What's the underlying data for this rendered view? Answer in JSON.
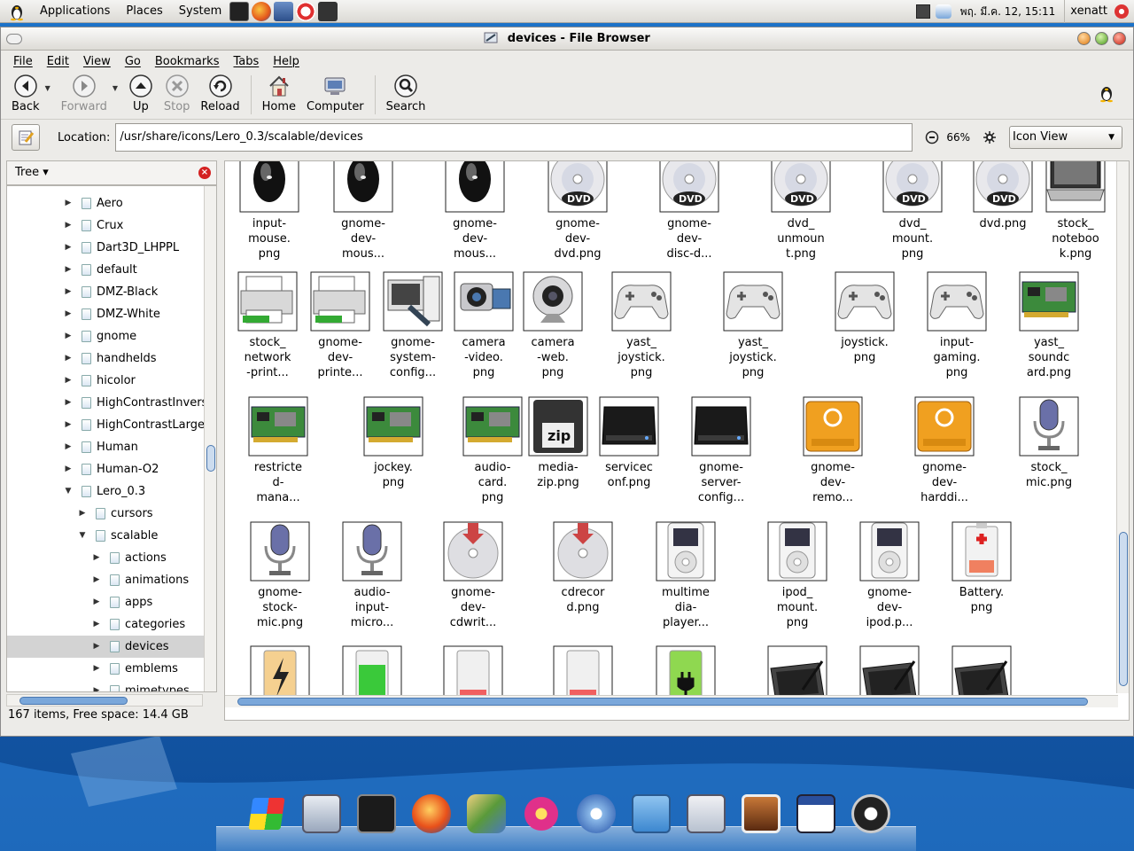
{
  "top_panel": {
    "menus": [
      "Applications",
      "Places",
      "System"
    ],
    "clock": "พฤ. มี.ค. 12, 15:11",
    "user": "xenatt"
  },
  "window": {
    "title": "devices - File Browser",
    "menubar": [
      "File",
      "Edit",
      "View",
      "Go",
      "Bookmarks",
      "Tabs",
      "Help"
    ],
    "toolbar": {
      "back": "Back",
      "forward": "Forward",
      "up": "Up",
      "stop": "Stop",
      "reload": "Reload",
      "home": "Home",
      "computer": "Computer",
      "search": "Search"
    },
    "location": {
      "label": "Location:",
      "path": "/usr/share/icons/Lero_0.3/scalable/devices",
      "zoom": "66%",
      "view_mode": "Icon View"
    },
    "sidebar": {
      "mode": "Tree",
      "items": [
        {
          "label": "Aero",
          "depth": 0,
          "expanded": false
        },
        {
          "label": "Crux",
          "depth": 0,
          "expanded": false
        },
        {
          "label": "Dart3D_LHPPL",
          "depth": 0,
          "expanded": false
        },
        {
          "label": "default",
          "depth": 0,
          "expanded": false
        },
        {
          "label": "DMZ-Black",
          "depth": 0,
          "expanded": false
        },
        {
          "label": "DMZ-White",
          "depth": 0,
          "expanded": false
        },
        {
          "label": "gnome",
          "depth": 0,
          "expanded": false
        },
        {
          "label": "handhelds",
          "depth": 0,
          "expanded": false
        },
        {
          "label": "hicolor",
          "depth": 0,
          "expanded": false
        },
        {
          "label": "HighContrastInvers",
          "depth": 0,
          "expanded": false
        },
        {
          "label": "HighContrastLarge",
          "depth": 0,
          "expanded": false
        },
        {
          "label": "Human",
          "depth": 0,
          "expanded": false
        },
        {
          "label": "Human-O2",
          "depth": 0,
          "expanded": false
        },
        {
          "label": "Lero_0.3",
          "depth": 0,
          "expanded": true
        },
        {
          "label": "cursors",
          "depth": 1,
          "expanded": false
        },
        {
          "label": "scalable",
          "depth": 1,
          "expanded": true
        },
        {
          "label": "actions",
          "depth": 2,
          "expanded": false
        },
        {
          "label": "animations",
          "depth": 2,
          "expanded": false
        },
        {
          "label": "apps",
          "depth": 2,
          "expanded": false
        },
        {
          "label": "categories",
          "depth": 2,
          "expanded": false
        },
        {
          "label": "devices",
          "depth": 2,
          "expanded": false,
          "selected": true
        },
        {
          "label": "emblems",
          "depth": 2,
          "expanded": false
        },
        {
          "label": "mimetypes",
          "depth": 2,
          "expanded": false
        }
      ]
    },
    "files": [
      {
        "label": "input-\nmouse.\npng",
        "icon": "mouse-icon"
      },
      {
        "label": "gnome-\ndev-\nmous...",
        "icon": "mouse-icon"
      },
      {
        "label": "gnome-\ndev-\nmous...",
        "icon": "mouse-icon"
      },
      {
        "label": "gnome-\ndev-\ndvd.png",
        "icon": "dvd-icon"
      },
      {
        "label": "gnome-\ndev-\ndisc-d...",
        "icon": "dvd-icon"
      },
      {
        "label": "dvd_\nunmoun\nt.png",
        "icon": "dvd-icon"
      },
      {
        "label": "dvd_\nmount.\npng",
        "icon": "dvd-icon"
      },
      {
        "label": "dvd.png",
        "icon": "dvd-icon"
      },
      {
        "label": "stock_\nnoteboo\nk.png",
        "icon": "laptop-icon"
      },
      {
        "label": "stock_\nnetwork\n-print...",
        "icon": "printer-icon"
      },
      {
        "label": "gnome-\ndev-\nprinte...",
        "icon": "printer-icon"
      },
      {
        "label": "gnome-\nsystem-\nconfig...",
        "icon": "system-config-icon"
      },
      {
        "label": "camera\n-video.\npng",
        "icon": "video-camera-icon"
      },
      {
        "label": "camera\n-web.\npng",
        "icon": "webcam-icon"
      },
      {
        "label": "yast_\njoystick.\npng",
        "icon": "gamepad-icon"
      },
      {
        "label": "yast_\njoystick.\npng",
        "icon": "gamepad-icon"
      },
      {
        "label": "joystick.\npng",
        "icon": "gamepad-icon"
      },
      {
        "label": "input-\ngaming.\npng",
        "icon": "gamepad-icon"
      },
      {
        "label": "yast_\nsoundc\nard.png",
        "icon": "sound-card-icon"
      },
      {
        "label": "restricte\nd-\nmana...",
        "icon": "sound-card-icon"
      },
      {
        "label": "jockey.\npng",
        "icon": "sound-card-icon"
      },
      {
        "label": "audio-\ncard.\npng",
        "icon": "sound-card-icon"
      },
      {
        "label": "media-\nzip.png",
        "icon": "zip-disk-icon"
      },
      {
        "label": "servicec\nonf.png",
        "icon": "hard-drive-icon"
      },
      {
        "label": "gnome-\nserver-\nconfig...",
        "icon": "hard-drive-icon"
      },
      {
        "label": "gnome-\ndev-\nremo...",
        "icon": "firewire-drive-icon"
      },
      {
        "label": "gnome-\ndev-\nharddi...",
        "icon": "firewire-drive-icon"
      },
      {
        "label": "stock_\nmic.png",
        "icon": "microphone-icon"
      },
      {
        "label": "gnome-\nstock-\nmic.png",
        "icon": "microphone-icon"
      },
      {
        "label": "audio-\ninput-\nmicro...",
        "icon": "microphone-icon"
      },
      {
        "label": "gnome-\ndev-\ncdwrit...",
        "icon": "cd-writer-icon"
      },
      {
        "label": "cdrecor\nd.png",
        "icon": "cd-writer-icon"
      },
      {
        "label": "multime\ndia-\nplayer...",
        "icon": "ipod-icon"
      },
      {
        "label": "ipod_\nmount.\npng",
        "icon": "ipod-icon"
      },
      {
        "label": "gnome-\ndev-\nipod.p...",
        "icon": "ipod-icon"
      },
      {
        "label": "Battery.\npng",
        "icon": "battery-icon"
      },
      {
        "label": "",
        "icon": "battery-charging-icon"
      },
      {
        "label": "",
        "icon": "battery-full-icon"
      },
      {
        "label": "",
        "icon": "battery-low-icon"
      },
      {
        "label": "",
        "icon": "battery-low-icon"
      },
      {
        "label": "",
        "icon": "battery-plug-icon"
      },
      {
        "label": "",
        "icon": "tablet-icon"
      },
      {
        "label": "",
        "icon": "tablet-icon"
      },
      {
        "label": "",
        "icon": "tablet-icon"
      }
    ],
    "status": "167 items, Free space: 14.4 GB"
  },
  "dock": [
    "windows-logo-icon",
    "display-settings-icon",
    "terminal-icon",
    "firefox-icon",
    "inkscape-icon",
    "flower-icon",
    "music-icon",
    "file-cabinet-icon",
    "screenshot-icon",
    "image-viewer-icon",
    "calendar-icon",
    "power-icon"
  ],
  "colors": {
    "accent": "#4a78b0",
    "desktop": "#1a66b8"
  }
}
